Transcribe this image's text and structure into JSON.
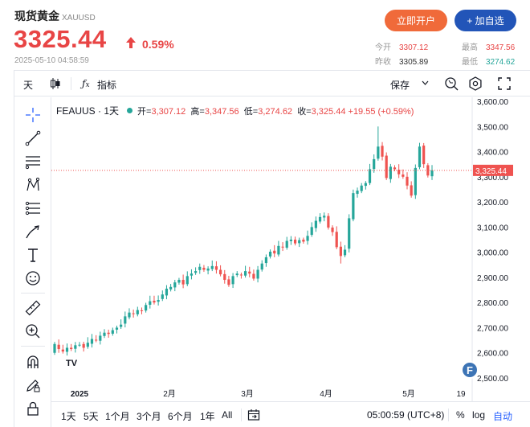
{
  "quote": {
    "name": "现货黄金",
    "symbol": "XAUUSD",
    "price": "3325.44",
    "change_pct": "0.59%",
    "timestamp": "2025-05-10 04:58:59",
    "open_account_label": "立即开户",
    "add_watch_label": "+ 加自选",
    "stats": [
      {
        "label": "今开",
        "value": "3307.12",
        "color": "#e84545"
      },
      {
        "label": "最高",
        "value": "3347.56",
        "color": "#e84545"
      },
      {
        "label": "昨收",
        "value": "3305.89",
        "color": "#333333"
      },
      {
        "label": "最低",
        "value": "3274.62",
        "color": "#26a69a"
      }
    ]
  },
  "toolbar": {
    "interval": "天",
    "indicators_label": "指标",
    "save_label": "保存"
  },
  "legend": {
    "symbol": "FEAUUS · 1天",
    "open_label": "开=",
    "open": "3,307.12",
    "high_label": "高=",
    "high": "3,347.56",
    "low_label": "低=",
    "low": "3,274.62",
    "close_label": "收=",
    "close": "3,325.44",
    "change": "+19.55 (+0.59%)"
  },
  "ranges": {
    "r1": "1天",
    "r2": "5天",
    "r3": "1个月",
    "r4": "3个月",
    "r5": "6个月",
    "r6": "1年",
    "r7": "All",
    "clock": "05:00:59 (UTC+8)",
    "pct": "%",
    "log": "log",
    "auto": "自动"
  },
  "colors": {
    "up": "#26a69a",
    "down": "#ef5350",
    "accent": "#e84545",
    "brand": "#2255b8"
  },
  "chart_data": {
    "type": "candlestick",
    "symbol": "FEAUUS",
    "interval": "1天",
    "y_axis": {
      "min": 2500,
      "max": 3600,
      "ticks": [
        "3,600.00",
        "3,500.00",
        "3,400.00",
        "3,300.00",
        "3,200.00",
        "3,100.00",
        "3,000.00",
        "2,900.00",
        "2,800.00",
        "2,700.00",
        "2,600.00",
        "2,500.00"
      ]
    },
    "x_labels": [
      "2025",
      "2月",
      "3月",
      "4月",
      "5月",
      "19"
    ],
    "last_price_label": "3,325.44",
    "last_price": 3325.44,
    "closes": [
      2635,
      2615,
      2605,
      2620,
      2615,
      2630,
      2632,
      2620,
      2640,
      2655,
      2650,
      2668,
      2680,
      2675,
      2690,
      2700,
      2712,
      2745,
      2760,
      2755,
      2770,
      2768,
      2790,
      2805,
      2800,
      2810,
      2832,
      2855,
      2862,
      2880,
      2890,
      2872,
      2905,
      2915,
      2925,
      2942,
      2930,
      2935,
      2945,
      2930,
      2912,
      2890,
      2870,
      2905,
      2915,
      2910,
      2925,
      2915,
      2895,
      2930,
      2955,
      2980,
      3002,
      2995,
      3025,
      3020,
      3045,
      3050,
      3035,
      3048,
      3042,
      3065,
      3100,
      3125,
      3140,
      3145,
      3098,
      3080,
      3020,
      2985,
      3010,
      3135,
      3235,
      3245,
      3265,
      3275,
      3330,
      3370,
      3420,
      3380,
      3295,
      3340,
      3330,
      3310,
      3300,
      3265,
      3225,
      3335,
      3420,
      3350,
      3305,
      3325.44
    ],
    "wick_range": [
      2550,
      3500
    ]
  }
}
